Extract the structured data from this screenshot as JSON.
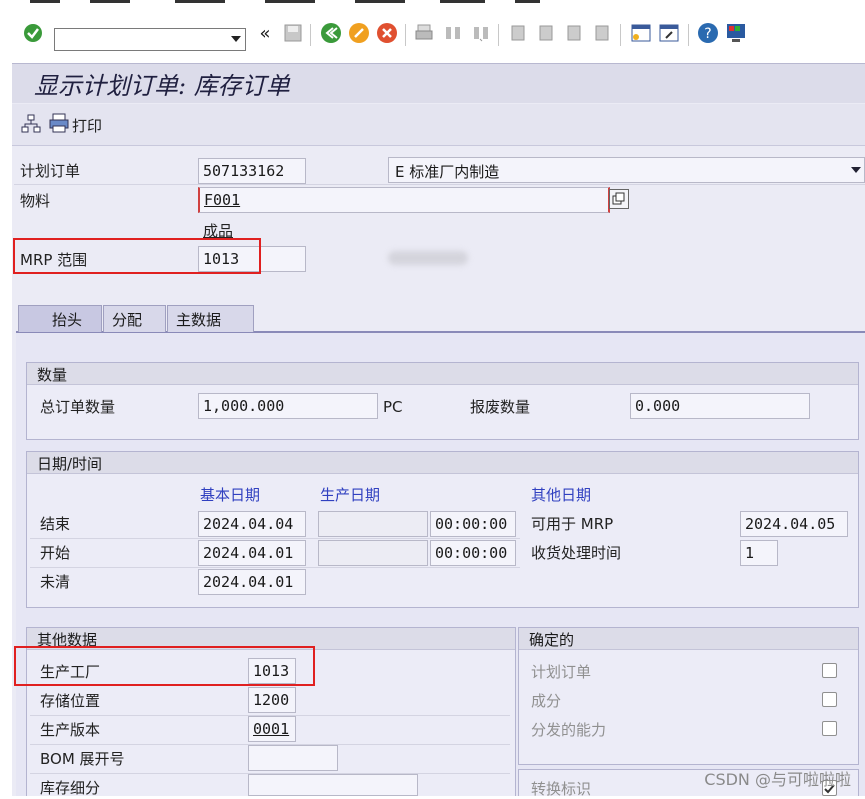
{
  "title": "显示计划订单: 库存订单",
  "app_toolbar": {
    "print_label": "打印"
  },
  "header": {
    "planned_order_label": "计划订单",
    "planned_order_value": "507133162",
    "procurement_value": "E 标准厂内制造",
    "material_label": "物料",
    "material_value": "F001",
    "material_desc": "成品",
    "mrp_area_label": "MRP 范围",
    "mrp_area_value": "1013"
  },
  "tabs": [
    "抬头",
    "分配",
    "主数据"
  ],
  "quantity": {
    "title": "数量",
    "total_label": "总订单数量",
    "total_value": "1,000.000",
    "unit": "PC",
    "scrap_label": "报废数量",
    "scrap_value": "0.000"
  },
  "dates": {
    "title": "日期/时间",
    "basic_dates": "基本日期",
    "production_dates": "生产日期",
    "other_dates": "其他日期",
    "end_label": "结束",
    "end_basic": "2024.04.04",
    "end_prod_time": "00:00:00",
    "start_label": "开始",
    "start_basic": "2024.04.01",
    "start_prod_time": "00:00:00",
    "open_label": "未清",
    "open_basic": "2024.04.01",
    "avail_mrp_label": "可用于 MRP",
    "avail_mrp_value": "2024.04.05",
    "gr_time_label": "收货处理时间",
    "gr_time_value": "1"
  },
  "other_data": {
    "title": "其他数据",
    "plant_label": "生产工厂",
    "plant_value": "1013",
    "storage_label": "存储位置",
    "storage_value": "1200",
    "version_label": "生产版本",
    "version_value": "0001",
    "bom_label": "BOM 展开号",
    "stock_label": "库存细分"
  },
  "firmed": {
    "title": "确定的",
    "planned_order_label": "计划订单",
    "components_label": "成分",
    "capacity_label": "分发的能力",
    "conversion_label": "转换标识"
  },
  "watermark": "CSDN @与可啦啦啦",
  "colors": {
    "highlight": "#e02020",
    "accent": "#3040c0"
  }
}
